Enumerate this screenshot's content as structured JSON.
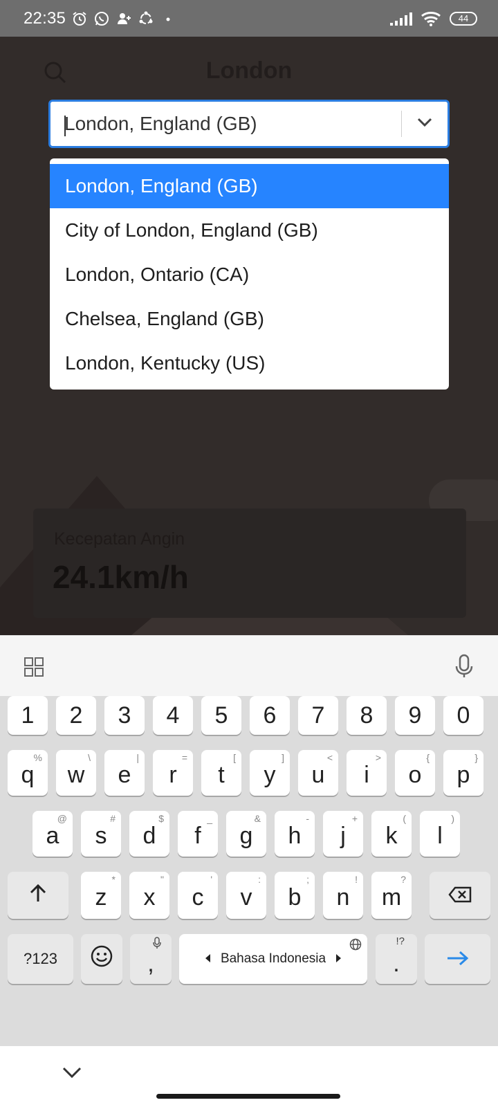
{
  "status_bar": {
    "time": "22:35",
    "battery": "44"
  },
  "app": {
    "title": "London",
    "wind_label": "Kecepatan Angin",
    "wind_value": "24.1km/h"
  },
  "select": {
    "value": "London, England (GB)",
    "accent_color": "#2684ff"
  },
  "dropdown": {
    "options": [
      "London, England (GB)",
      "City of London, England (GB)",
      "London, Ontario (CA)",
      "Chelsea, England (GB)",
      "London, Kentucky (US)"
    ],
    "selected_index": 0
  },
  "keyboard": {
    "numbers": [
      "1",
      "2",
      "3",
      "4",
      "5",
      "6",
      "7",
      "8",
      "9",
      "0"
    ],
    "row1": [
      {
        "k": "q",
        "h": "%"
      },
      {
        "k": "w",
        "h": "\\"
      },
      {
        "k": "e",
        "h": "|"
      },
      {
        "k": "r",
        "h": "="
      },
      {
        "k": "t",
        "h": "["
      },
      {
        "k": "y",
        "h": "]"
      },
      {
        "k": "u",
        "h": "<"
      },
      {
        "k": "i",
        "h": ">"
      },
      {
        "k": "o",
        "h": "{"
      },
      {
        "k": "p",
        "h": "}"
      }
    ],
    "row2": [
      {
        "k": "a",
        "h": "@"
      },
      {
        "k": "s",
        "h": "#"
      },
      {
        "k": "d",
        "h": "$"
      },
      {
        "k": "f",
        "h": "_"
      },
      {
        "k": "g",
        "h": "&"
      },
      {
        "k": "h",
        "h": "-"
      },
      {
        "k": "j",
        "h": "+"
      },
      {
        "k": "k",
        "h": "("
      },
      {
        "k": "l",
        "h": ")"
      }
    ],
    "row3": [
      {
        "k": "z",
        "h": "*"
      },
      {
        "k": "x",
        "h": "\""
      },
      {
        "k": "c",
        "h": "'"
      },
      {
        "k": "v",
        "h": ":"
      },
      {
        "k": "b",
        "h": ";"
      },
      {
        "k": "n",
        "h": "!"
      },
      {
        "k": "m",
        "h": "?"
      }
    ],
    "symbols_label": "?123",
    "comma": ",",
    "space_label": "Bahasa Indonesia",
    "period": ".",
    "period_hint": "!?",
    "enter_color": "#2a8ae8"
  }
}
